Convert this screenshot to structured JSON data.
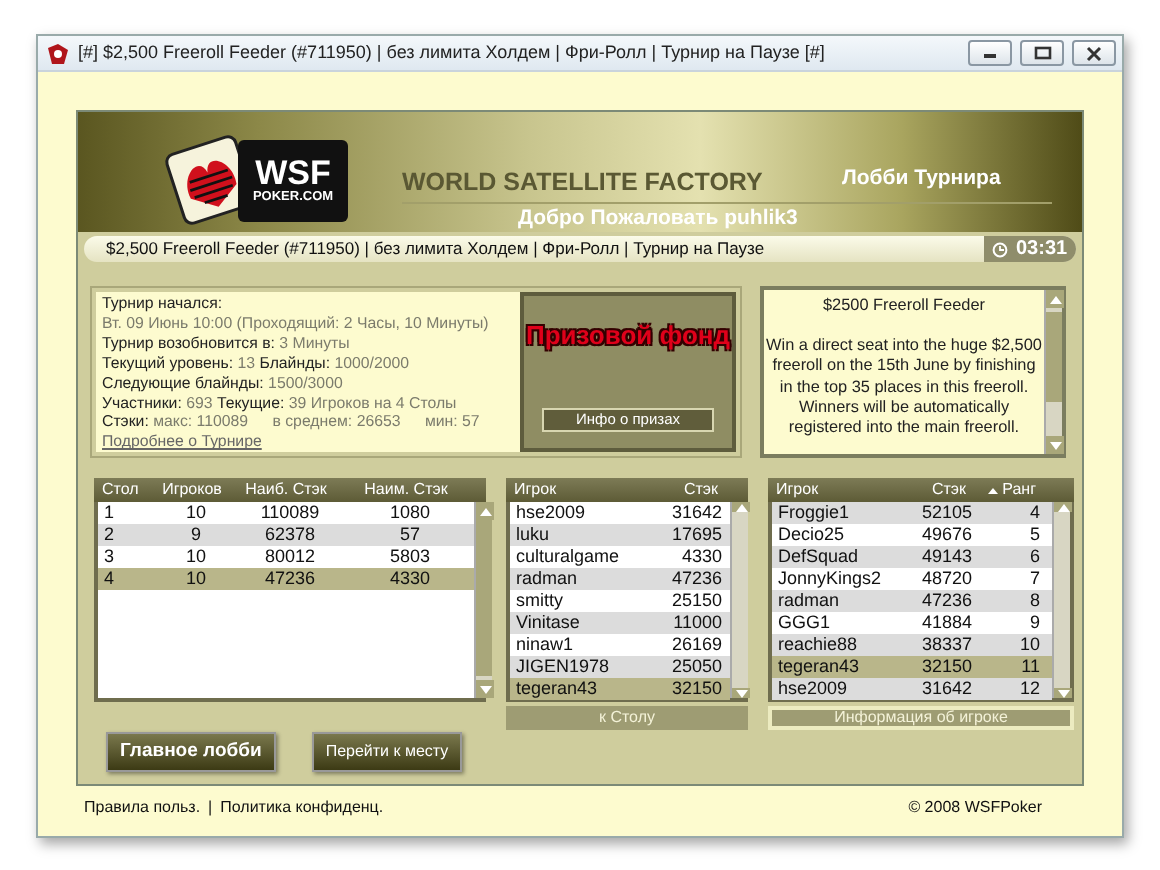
{
  "window": {
    "title": "[#] $2,500 Freeroll Feeder (#711950)  |  без лимита Холдем  |  Фри-Ролл   |  Турнир на Паузе [#]"
  },
  "header": {
    "logo_text": "WSF",
    "logo_sub": "POKER.COM",
    "brand": "WORLD SATELLITE FACTORY",
    "lobby_title": "Лобби Турнира",
    "welcome": "Добро Пожаловать puhlik3"
  },
  "info_bar": {
    "text": "$2,500 Freeroll Feeder (#711950)  |  без лимита Холдем  |  Фри-Ролл   |  Турнир на Паузе",
    "timer": "03:31"
  },
  "tournament_info": {
    "lines": [
      [
        {
          "kind": "label",
          "text": "Турнир начался:"
        }
      ],
      [
        {
          "kind": "value",
          "text": "Вт. 09 Июнь 10:00 (Проходящий: 2 Часы, 10 Минуты)"
        }
      ],
      [
        {
          "kind": "label",
          "text": "Турнир возобновится в:"
        },
        {
          "kind": "value",
          "text": "3 Минуты"
        }
      ],
      [
        {
          "kind": "label",
          "text": "Текущий уровень:"
        },
        {
          "kind": "value",
          "text": "13"
        },
        {
          "kind": "label",
          "text": "Блайнды:"
        },
        {
          "kind": "value",
          "text": "1000/2000"
        }
      ],
      [
        {
          "kind": "label",
          "text": "Следующие блайнды:"
        },
        {
          "kind": "value",
          "text": "1500/3000"
        }
      ],
      [
        {
          "kind": "label",
          "text": "Участники:"
        },
        {
          "kind": "value",
          "text": "693"
        },
        {
          "kind": "label",
          "text": "Текущие:"
        },
        {
          "kind": "value",
          "text": "39 Игроков на 4 Столы"
        }
      ],
      [
        {
          "kind": "label",
          "text": "Стэки:"
        },
        {
          "kind": "value",
          "text": "макс: 110089"
        },
        {
          "kind": "value",
          "text": "в среднем: 26653"
        },
        {
          "kind": "value",
          "text": "мин: 57"
        }
      ]
    ],
    "link": "Подробнее о Турнире"
  },
  "prize_pool": {
    "title": "Призовой фонд",
    "button": "Инфо о призах"
  },
  "description": {
    "title": "$2500 Freeroll Feeder",
    "body": "Win a direct seat into the huge $2,500 freeroll on the 15th June by finishing in the top 35 places in this freeroll. Winners will be automatically registered into the main freeroll."
  },
  "tables_list": {
    "columns": [
      "Стол",
      "Игроков",
      "Наиб. Стэк",
      "Наим. Стэк"
    ],
    "rows": [
      {
        "cells": [
          "1",
          "10",
          "110089",
          "1080"
        ],
        "selected": false
      },
      {
        "cells": [
          "2",
          "9",
          "62378",
          "57"
        ],
        "selected": false
      },
      {
        "cells": [
          "3",
          "10",
          "80012",
          "5803"
        ],
        "selected": false
      },
      {
        "cells": [
          "4",
          "10",
          "47236",
          "4330"
        ],
        "selected": true
      }
    ]
  },
  "players": {
    "columns": [
      "Игрок",
      "Стэк"
    ],
    "rows": [
      {
        "cells": [
          "hse2009",
          "31642"
        ],
        "selected": false
      },
      {
        "cells": [
          "luku",
          "17695"
        ],
        "selected": false
      },
      {
        "cells": [
          "culturalgame",
          "4330"
        ],
        "selected": false
      },
      {
        "cells": [
          "radman",
          "47236"
        ],
        "selected": false
      },
      {
        "cells": [
          "smitty",
          "25150"
        ],
        "selected": false
      },
      {
        "cells": [
          "Vinitase",
          "11000"
        ],
        "selected": false
      },
      {
        "cells": [
          "ninaw1",
          "26169"
        ],
        "selected": false
      },
      {
        "cells": [
          "JIGEN1978",
          "25050"
        ],
        "selected": false
      },
      {
        "cells": [
          "tegeran43",
          "32150"
        ],
        "selected": true
      }
    ],
    "button": "к Столу"
  },
  "rankings": {
    "columns": [
      {
        "label": "Игрок",
        "sorted": false
      },
      {
        "label": "Стэк",
        "sorted": false
      },
      {
        "label": "Ранг",
        "sorted": true
      }
    ],
    "rows": [
      {
        "cells": [
          "Froggie1",
          "52105",
          "4"
        ],
        "selected": false
      },
      {
        "cells": [
          "Decio25",
          "49676",
          "5"
        ],
        "selected": false
      },
      {
        "cells": [
          "DefSquad",
          "49143",
          "6"
        ],
        "selected": false
      },
      {
        "cells": [
          "JonnyKings2",
          "48720",
          "7"
        ],
        "selected": false
      },
      {
        "cells": [
          "radman",
          "47236",
          "8"
        ],
        "selected": false
      },
      {
        "cells": [
          "GGG1",
          "41884",
          "9"
        ],
        "selected": false
      },
      {
        "cells": [
          "reachie88",
          "38337",
          "10"
        ],
        "selected": false
      },
      {
        "cells": [
          "tegeran43",
          "32150",
          "11"
        ],
        "selected": true
      },
      {
        "cells": [
          "hse2009",
          "31642",
          "12"
        ],
        "selected": false
      }
    ],
    "button": "Информация об игроке"
  },
  "buttons": [
    "Главное лобби",
    "Перейти к месту"
  ],
  "footer": {
    "separator": "|",
    "links": [
      "Правила польз.",
      "Политика конфиденц."
    ],
    "copyright": "© 2008 WSFPoker"
  }
}
